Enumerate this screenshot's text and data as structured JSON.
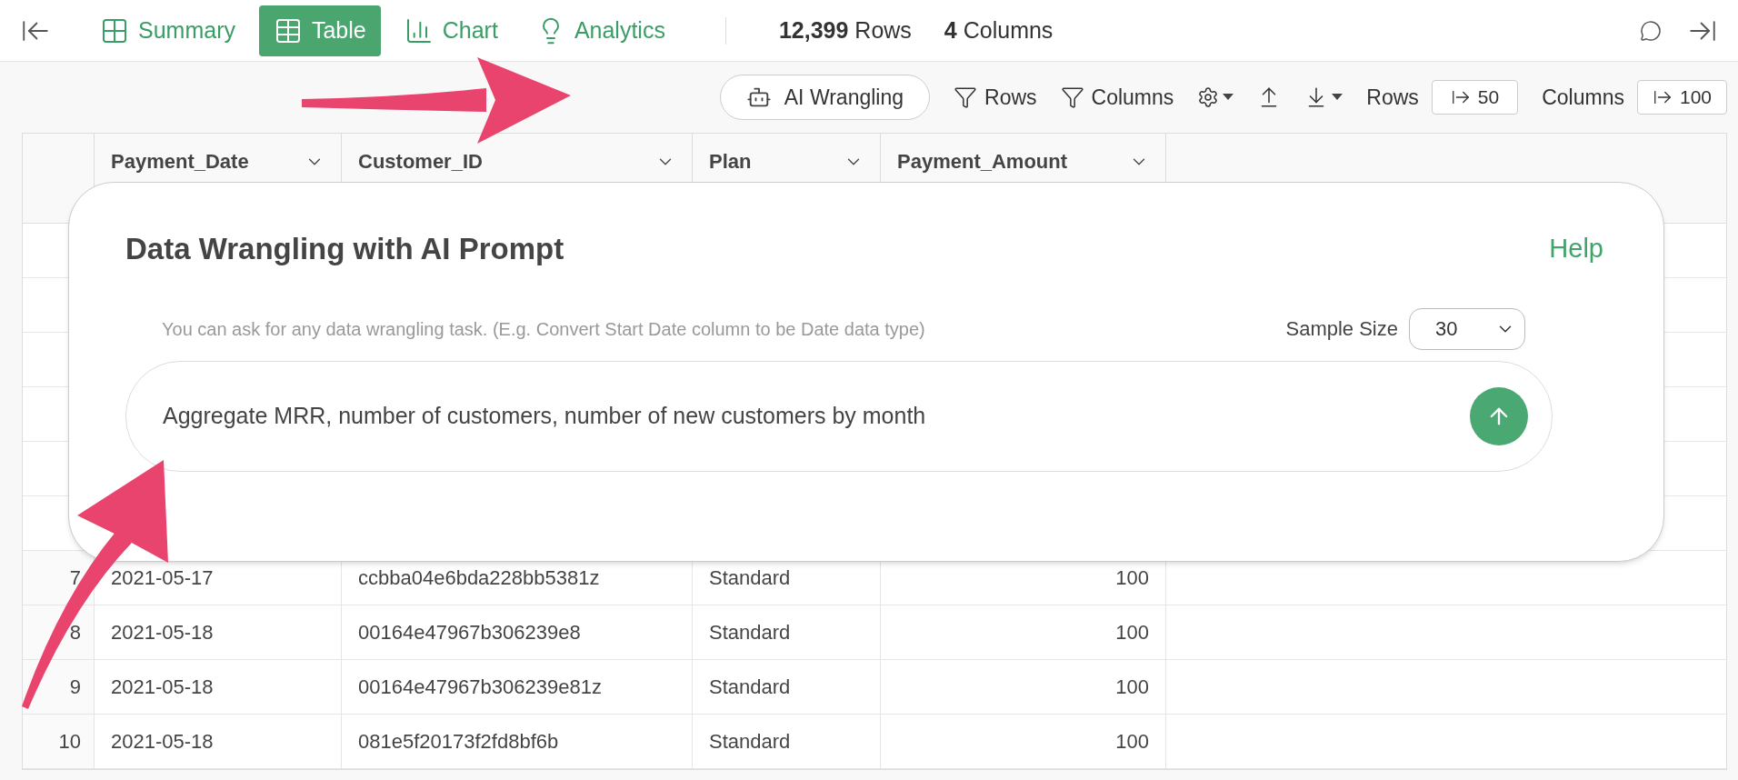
{
  "top_bar": {
    "tabs": [
      {
        "kind": "summary",
        "label": "Summary",
        "selected": false
      },
      {
        "kind": "table",
        "label": "Table",
        "selected": true
      },
      {
        "kind": "chart",
        "label": "Chart",
        "selected": false
      },
      {
        "kind": "analytics",
        "label": "Analytics",
        "selected": false
      }
    ],
    "row_count": "12,399",
    "row_count_label": "Rows",
    "column_count": "4",
    "column_count_label": "Columns"
  },
  "toolbar": {
    "ai_button": "AI Wrangling",
    "row_filter": "Rows",
    "column_filter": "Columns",
    "rows_label": "Rows",
    "rows_value": "50",
    "columns_label": "Columns",
    "columns_value": "100"
  },
  "table": {
    "columns": [
      {
        "label": "Payment_Date",
        "kind": "text"
      },
      {
        "label": "Customer_ID",
        "kind": "text"
      },
      {
        "label": "Plan",
        "kind": "text"
      },
      {
        "label": "Payment_Amount",
        "kind": "number"
      }
    ],
    "rows": [
      {
        "num": "7",
        "cells": [
          "2021-05-17",
          "ccbba04e6bda228bb5381z",
          "Standard",
          "100"
        ]
      },
      {
        "num": "8",
        "cells": [
          "2021-05-18",
          "00164e47967b306239e8",
          "Standard",
          "100"
        ]
      },
      {
        "num": "9",
        "cells": [
          "2021-05-18",
          "00164e47967b306239e81z",
          "Standard",
          "100"
        ]
      },
      {
        "num": "10",
        "cells": [
          "2021-05-18",
          "081e5f20173f2fd8bf6b",
          "Standard",
          "100"
        ]
      }
    ]
  },
  "dialog": {
    "title": "Data Wrangling with AI Prompt",
    "help": "Help",
    "hint": "You can ask for any data wrangling task. (E.g. Convert Start Date column to be Date data type)",
    "sample_size_label": "Sample Size",
    "sample_size": "30",
    "prompt": "Aggregate MRR, number of customers, number of new customers by month"
  }
}
